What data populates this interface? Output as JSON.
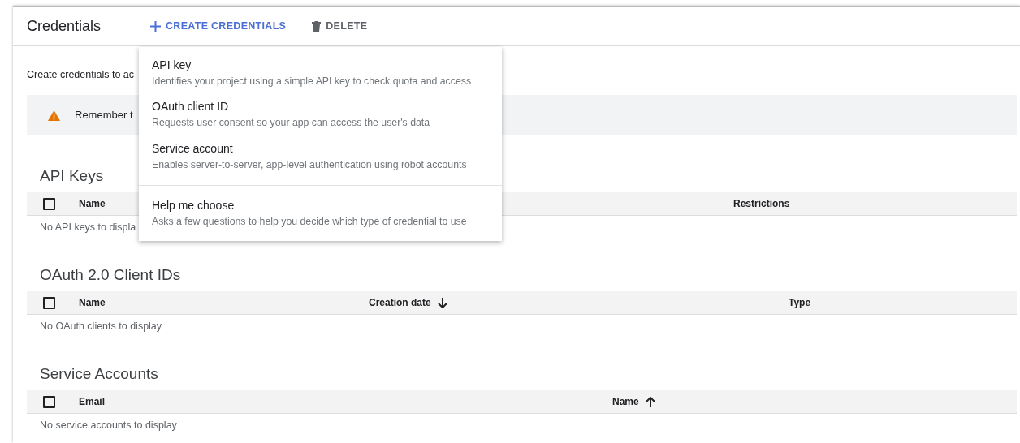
{
  "header": {
    "title": "Credentials",
    "actions": [
      {
        "label": "CREATE CREDENTIALS",
        "kind": "create"
      },
      {
        "label": "DELETE",
        "kind": "delete"
      }
    ]
  },
  "intro": "Create credentials to ac",
  "banner": {
    "text": "Remember t"
  },
  "sections": [
    {
      "title": "API Keys",
      "select_all_checked": false,
      "columns": [
        {
          "label": "Name"
        },
        {
          "label": "Restrictions"
        }
      ],
      "empty": "No API keys to displa"
    },
    {
      "title": "OAuth 2.0 Client IDs",
      "select_all_checked": false,
      "columns": [
        {
          "label": "Name"
        },
        {
          "label": "Creation date",
          "sorted": true,
          "descending": true
        },
        {
          "label": "Type"
        }
      ],
      "empty": "No OAuth clients to display"
    },
    {
      "title": "Service Accounts",
      "select_all_checked": false,
      "columns": [
        {
          "label": "Email"
        },
        {
          "label": "Name",
          "sorted": true,
          "descending": false
        }
      ],
      "empty": "No service accounts to display"
    }
  ],
  "menu": {
    "items": [
      {
        "title": "API key",
        "description": "Identifies your project using a simple API key to check quota and access"
      },
      {
        "title": "OAuth client ID",
        "description": "Requests user consent so your app can access the user's data"
      },
      {
        "title": "Service account",
        "description": "Enables server-to-server, app-level authentication using robot accounts"
      },
      {
        "title": "Help me choose",
        "description": "Asks a few questions to help you decide which type of credential to use",
        "divider": true
      }
    ]
  }
}
